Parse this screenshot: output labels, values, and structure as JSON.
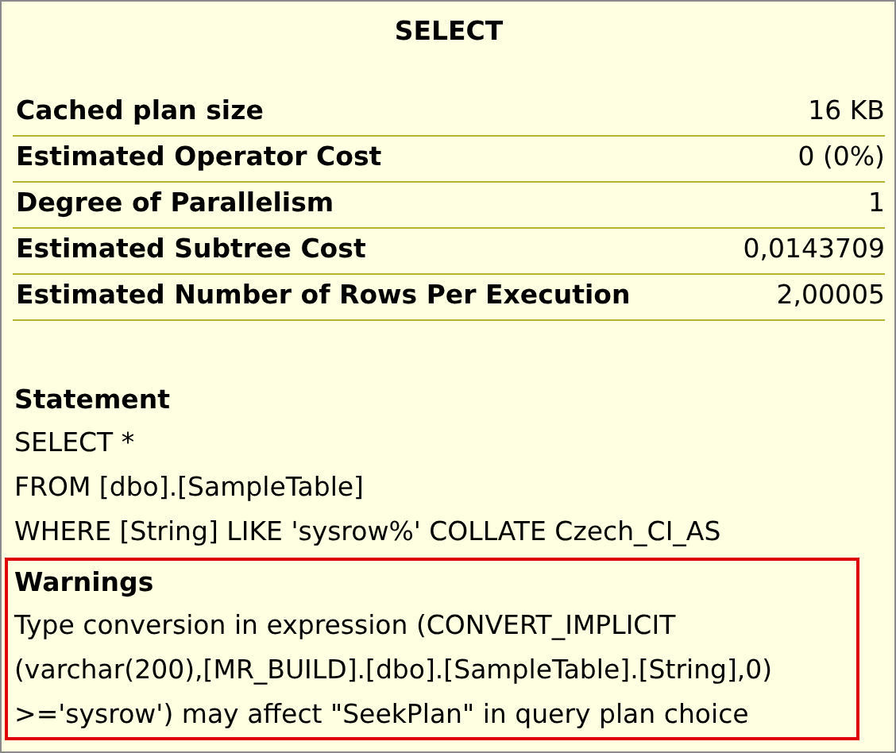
{
  "title": "SELECT",
  "properties": [
    {
      "name": "Cached plan size",
      "value": "16 KB"
    },
    {
      "name": "Estimated Operator Cost",
      "value": "0 (0%)"
    },
    {
      "name": "Degree of Parallelism",
      "value": "1"
    },
    {
      "name": "Estimated Subtree Cost",
      "value": "0,0143709"
    },
    {
      "name": "Estimated Number of Rows Per Execution",
      "value": "2,00005"
    }
  ],
  "sections": [
    {
      "heading": "Statement",
      "highlighted": false,
      "lines": [
        "SELECT *",
        "FROM [dbo].[SampleTable]",
        "WHERE [String] LIKE 'sysrow%' COLLATE Czech_CI_AS"
      ]
    },
    {
      "heading": "Warnings",
      "highlighted": true,
      "lines": [
        "Type conversion in expression (CONVERT_IMPLICIT",
        "(varchar(200),[MR_BUILD].[dbo].[SampleTable].[String],0)",
        ">='sysrow') may affect \"SeekPlan\" in query plan choice"
      ]
    }
  ]
}
